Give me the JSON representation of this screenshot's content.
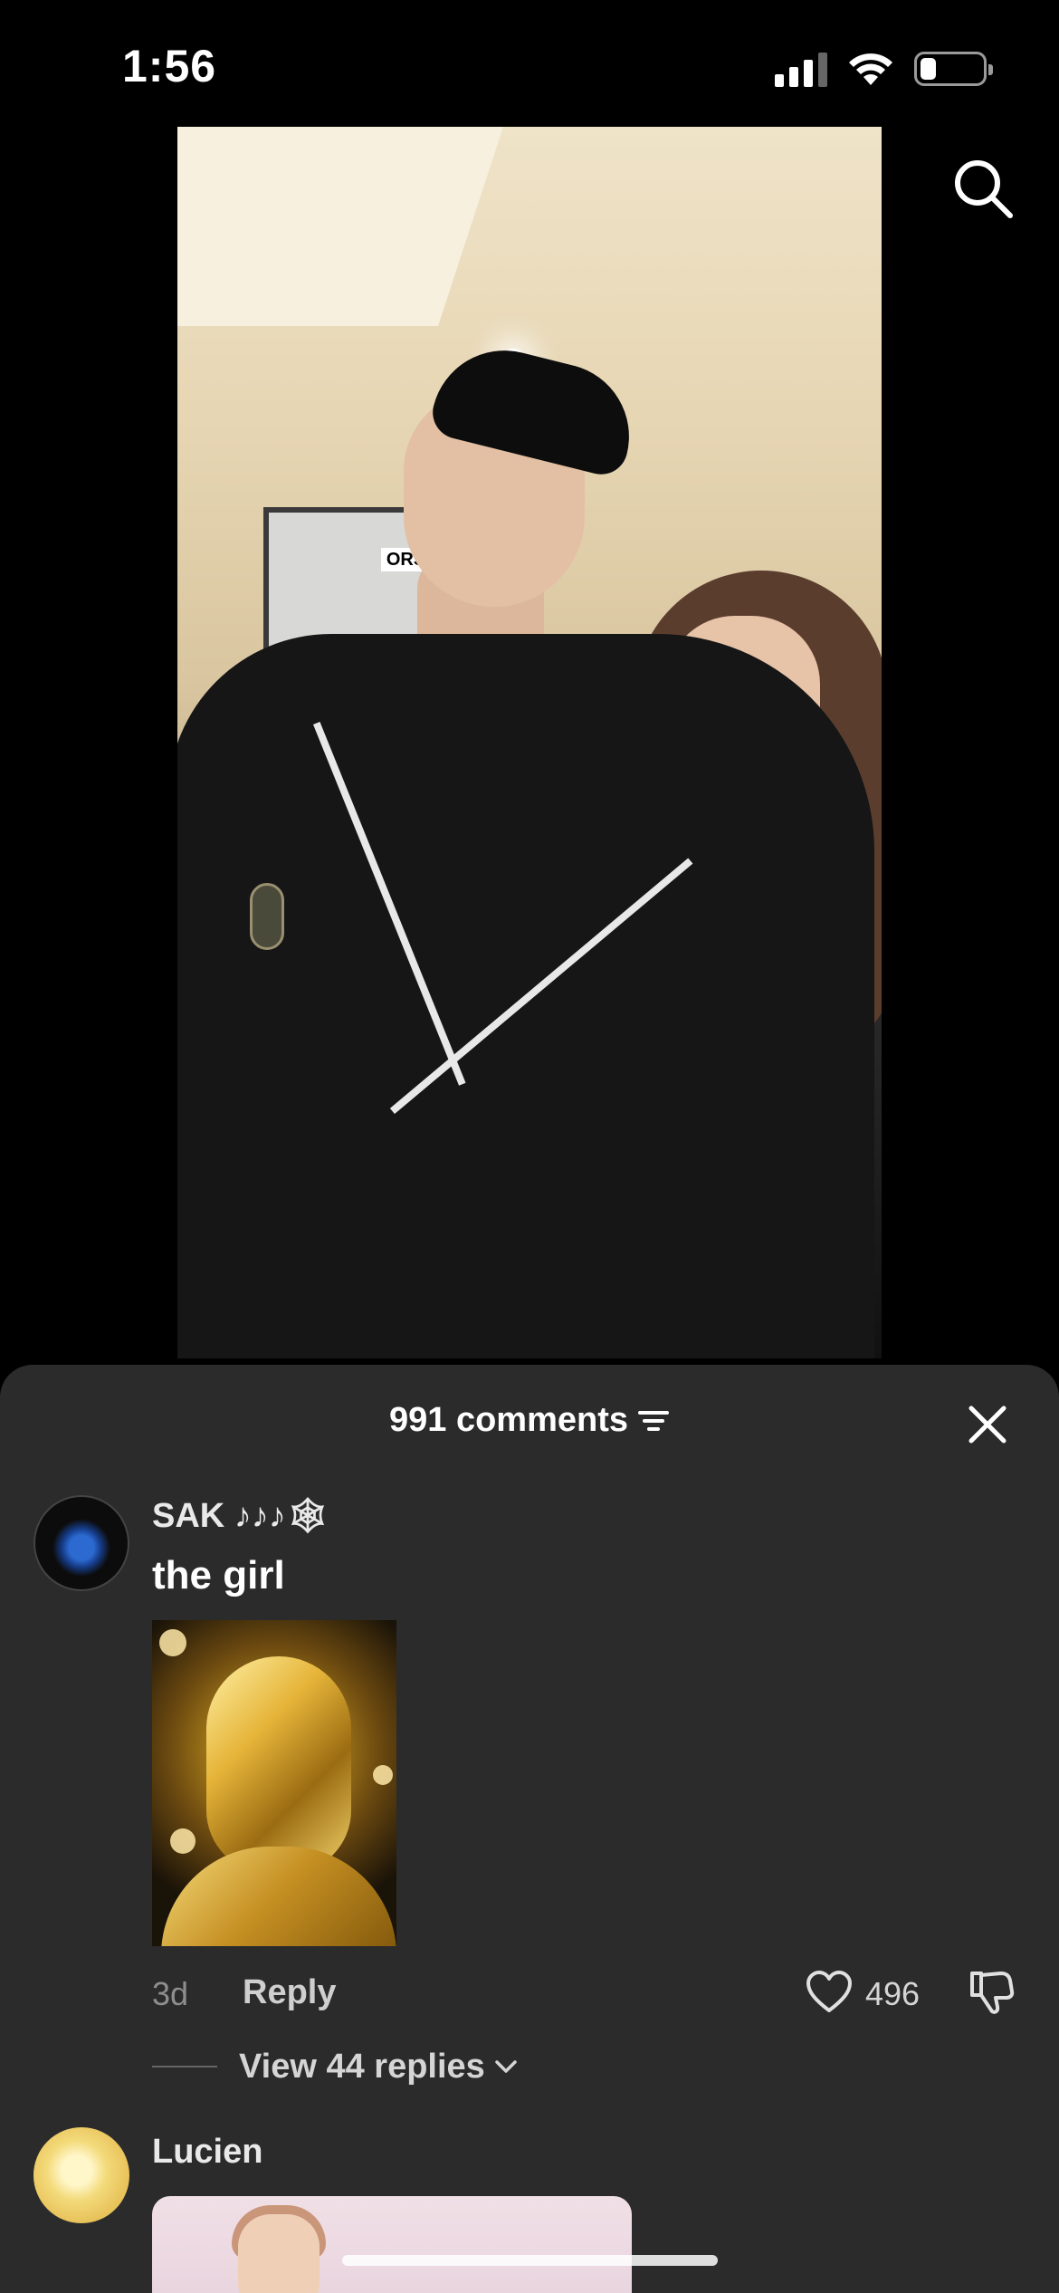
{
  "status_bar": {
    "time": "1:56",
    "icons": [
      "cellular-signal-icon",
      "wifi-icon",
      "battery-icon"
    ],
    "battery_level": 0.25
  },
  "video": {
    "search_icon": "search-icon",
    "sign_text": "ORS"
  },
  "comments_sheet": {
    "title": "991 comments",
    "filter_icon": "filter-icon",
    "close_icon": "close-icon",
    "background": "#2b2b2b",
    "comments": [
      {
        "username": "SAK ♪♪♪🕸",
        "text": "the girl",
        "time": "3d",
        "reply_label": "Reply",
        "likes": "496",
        "view_replies": "View 44 replies"
      },
      {
        "username": "Lucien"
      }
    ]
  }
}
